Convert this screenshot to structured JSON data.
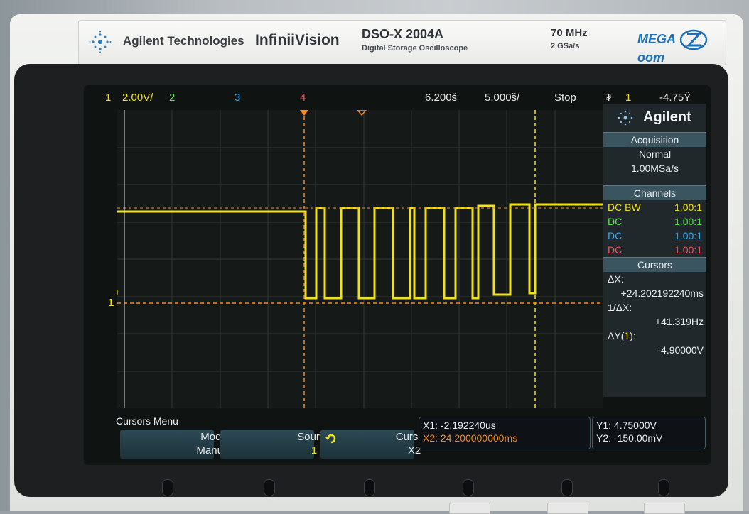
{
  "brand": {
    "company": "Agilent Technologies",
    "series": "InfiniiVision",
    "model": "DSO-X 2004A",
    "model_subtitle": "Digital Storage Oscilloscope",
    "bandwidth": "70 MHz",
    "sample_rate": "2 GSa/s",
    "megazoom": "MEGA",
    "megazoom_tail": "oom"
  },
  "topbar": {
    "ch1_label": "1",
    "ch1_scale": "2.00V/",
    "ch2_label": "2",
    "ch3_label": "3",
    "ch4_label": "4",
    "delay": "6.200š",
    "timebase": "5.000š/",
    "run_state": "Stop",
    "trigger_icon": "₮",
    "trigger_channel": "1",
    "trigger_level": "-4.75Ŷ"
  },
  "colors": {
    "ch1": "#f2e21a",
    "ch2": "#59e34b",
    "ch3": "#3aa9f0",
    "ch4": "#f0515e",
    "cursor": "#f28a1e"
  },
  "side": {
    "logo": "Agilent",
    "acquisition_title": "Acquisition",
    "acquisition_mode": "Normal",
    "acquisition_rate": "1.00MSa/s",
    "channels_title": "Channels",
    "channels": [
      {
        "coupling": "DC BW",
        "probe": "1.00:1"
      },
      {
        "coupling": "DC",
        "probe": "1.00:1"
      },
      {
        "coupling": "DC",
        "probe": "1.00:1"
      },
      {
        "coupling": "DC",
        "probe": "1.00:1"
      }
    ],
    "cursors_title": "Cursors",
    "dx_label": "ΔX:",
    "dx_value": "+24.202192240ms",
    "inv_dx_label": "1/ΔX:",
    "inv_dx_value": "+41.319Hz",
    "dy_label": "ΔY(",
    "dy_channel": "1",
    "dy_label_end": "):",
    "dy_value": "-4.90000V"
  },
  "bottom": {
    "menu_title": "Cursors Menu",
    "mode_label": "Mode",
    "mode_value": "Manual",
    "source_label": "Source",
    "source_value": "1",
    "cursors_label": "Cursors",
    "cursors_value": "X2",
    "x1": "X1: -2.192240us",
    "x2": "X2: 24.200000000ms",
    "y1": "Y1: 4.75000V",
    "y2": "Y2: -150.00mV"
  },
  "markers": {
    "ground_ch1": "1",
    "trigger_tag": "T"
  }
}
